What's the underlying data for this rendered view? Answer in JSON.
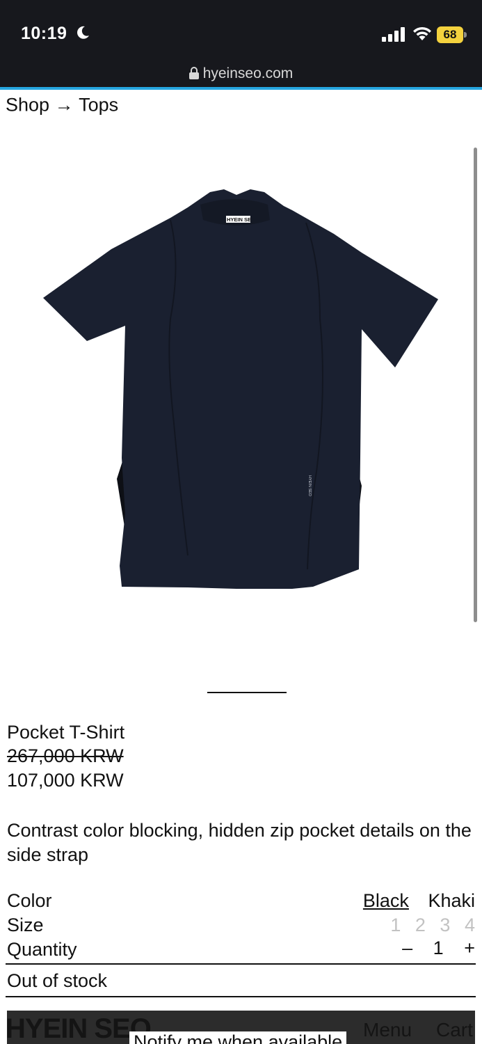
{
  "status_bar": {
    "time": "10:19",
    "battery": "68"
  },
  "browser": {
    "url": "hyeinseo.com"
  },
  "breadcrumb": {
    "shop": "Shop",
    "arrow": "→",
    "category": "Tops"
  },
  "product": {
    "name": "Pocket T-Shirt",
    "original_price": "267,000 KRW",
    "sale_price": "107,000 KRW",
    "description": "Contrast color blocking, hidden zip pocket details on the side strap",
    "neck_label": "HYEIN SE",
    "side_label": "HYEIN SEO"
  },
  "options": {
    "color_label": "Color",
    "colors": [
      "Black",
      "Khaki"
    ],
    "size_label": "Size",
    "sizes": [
      "1",
      "2",
      "3",
      "4"
    ],
    "quantity_label": "Quantity",
    "quantity_minus": "–",
    "quantity_value": "1",
    "quantity_plus": "+"
  },
  "stock_status": "Out of stock",
  "footer": {
    "brand": "HYEIN SEO",
    "notify": "Notify me when available",
    "menu": "Menu",
    "cart": "Cart"
  },
  "colors": {
    "status_bar_bg": "#17181d",
    "accent": "#26a6e0",
    "battery": "#f4d23e",
    "garment": "#1a2030"
  }
}
